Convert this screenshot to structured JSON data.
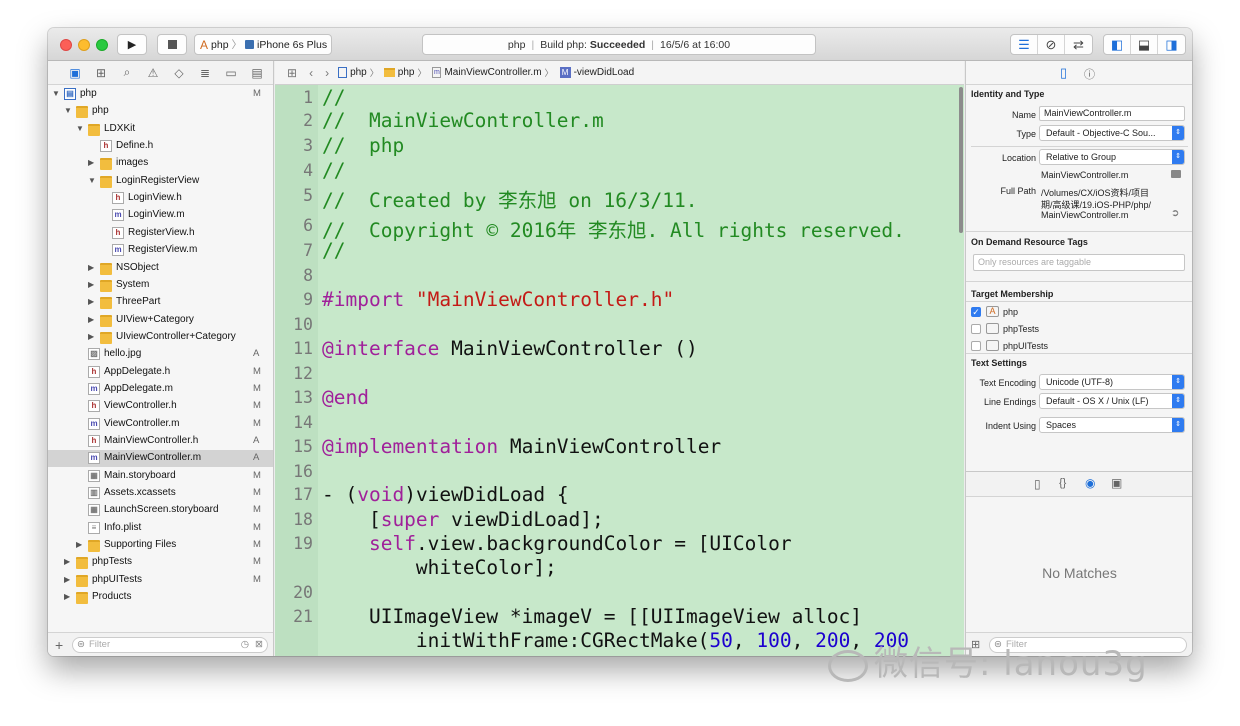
{
  "toolbar": {
    "scheme": "php",
    "device": "iPhone 6s Plus",
    "activity": {
      "project": "php",
      "status_prefix": "Build php: ",
      "status": "Succeeded",
      "timestamp": "16/5/6 at 16:00"
    }
  },
  "navigator": {
    "items": [
      {
        "label": "php",
        "type": "proj",
        "indent": 0,
        "tri": "open",
        "status": "M"
      },
      {
        "label": "php",
        "type": "folder",
        "indent": 1,
        "tri": "open",
        "status": ""
      },
      {
        "label": "LDXKit",
        "type": "folder",
        "indent": 2,
        "tri": "open",
        "status": ""
      },
      {
        "label": "Define.h",
        "type": "h",
        "indent": 3,
        "tri": "",
        "status": ""
      },
      {
        "label": "images",
        "type": "folder",
        "indent": 3,
        "tri": "closed",
        "status": ""
      },
      {
        "label": "LoginRegisterView",
        "type": "folder",
        "indent": 3,
        "tri": "open",
        "status": ""
      },
      {
        "label": "LoginView.h",
        "type": "h",
        "indent": 4,
        "tri": "",
        "status": ""
      },
      {
        "label": "LoginView.m",
        "type": "m",
        "indent": 4,
        "tri": "",
        "status": ""
      },
      {
        "label": "RegisterView.h",
        "type": "h",
        "indent": 4,
        "tri": "",
        "status": ""
      },
      {
        "label": "RegisterView.m",
        "type": "m",
        "indent": 4,
        "tri": "",
        "status": ""
      },
      {
        "label": "NSObject",
        "type": "folder",
        "indent": 3,
        "tri": "closed",
        "status": ""
      },
      {
        "label": "System",
        "type": "folder",
        "indent": 3,
        "tri": "closed",
        "status": ""
      },
      {
        "label": "ThreePart",
        "type": "folder",
        "indent": 3,
        "tri": "closed",
        "status": ""
      },
      {
        "label": "UIView+Category",
        "type": "folder",
        "indent": 3,
        "tri": "closed",
        "status": ""
      },
      {
        "label": "UIviewController+Category",
        "type": "folder",
        "indent": 3,
        "tri": "closed",
        "status": ""
      },
      {
        "label": "hello.jpg",
        "type": "img",
        "indent": 2,
        "tri": "",
        "status": "A"
      },
      {
        "label": "AppDelegate.h",
        "type": "h",
        "indent": 2,
        "tri": "",
        "status": "M"
      },
      {
        "label": "AppDelegate.m",
        "type": "m",
        "indent": 2,
        "tri": "",
        "status": "M"
      },
      {
        "label": "ViewController.h",
        "type": "h",
        "indent": 2,
        "tri": "",
        "status": "M"
      },
      {
        "label": "ViewController.m",
        "type": "m",
        "indent": 2,
        "tri": "",
        "status": "M"
      },
      {
        "label": "MainViewController.h",
        "type": "h",
        "indent": 2,
        "tri": "",
        "status": "A"
      },
      {
        "label": "MainViewController.m",
        "type": "m",
        "indent": 2,
        "tri": "",
        "status": "A",
        "selected": true
      },
      {
        "label": "Main.storyboard",
        "type": "sb",
        "indent": 2,
        "tri": "",
        "status": "M"
      },
      {
        "label": "Assets.xcassets",
        "type": "asset",
        "indent": 2,
        "tri": "",
        "status": "M"
      },
      {
        "label": "LaunchScreen.storyboard",
        "type": "sb",
        "indent": 2,
        "tri": "",
        "status": "M"
      },
      {
        "label": "Info.plist",
        "type": "plist",
        "indent": 2,
        "tri": "",
        "status": "M"
      },
      {
        "label": "Supporting Files",
        "type": "folder",
        "indent": 2,
        "tri": "closed",
        "status": "M"
      },
      {
        "label": "phpTests",
        "type": "folder",
        "indent": 1,
        "tri": "closed",
        "status": "M"
      },
      {
        "label": "phpUITests",
        "type": "folder",
        "indent": 1,
        "tri": "closed",
        "status": "M"
      },
      {
        "label": "Products",
        "type": "folder",
        "indent": 1,
        "tri": "closed",
        "status": ""
      }
    ],
    "filter_placeholder": "Filter"
  },
  "jumpbar": {
    "crumbs": [
      "php",
      "php",
      "MainViewController.m",
      "-viewDidLoad"
    ]
  },
  "editor": {
    "lines": [
      {
        "n": "1",
        "segs": [
          [
            "cm",
            "//"
          ]
        ]
      },
      {
        "n": "2",
        "segs": [
          [
            "cm",
            "//  MainViewController.m"
          ]
        ]
      },
      {
        "n": "3",
        "segs": [
          [
            "cm",
            "//  php"
          ]
        ]
      },
      {
        "n": "4",
        "segs": [
          [
            "cm",
            "//"
          ]
        ]
      },
      {
        "n": "5",
        "segs": [
          [
            "cm",
            "//  Created by 李东旭 on 16/3/11."
          ]
        ]
      },
      {
        "n": "6",
        "segs": [
          [
            "cm",
            "//  Copyright © 2016年 李东旭. All rights reserved."
          ]
        ]
      },
      {
        "n": "7",
        "segs": [
          [
            "cm",
            "//"
          ]
        ]
      },
      {
        "n": "8",
        "segs": []
      },
      {
        "n": "9",
        "segs": [
          [
            "kw",
            "#import "
          ],
          [
            "str",
            "\"MainViewController.h\""
          ]
        ]
      },
      {
        "n": "10",
        "segs": []
      },
      {
        "n": "11",
        "segs": [
          [
            "kw",
            "@interface"
          ],
          [
            "",
            " MainViewController ()"
          ]
        ]
      },
      {
        "n": "12",
        "segs": []
      },
      {
        "n": "13",
        "segs": [
          [
            "kw",
            "@end"
          ]
        ]
      },
      {
        "n": "14",
        "segs": []
      },
      {
        "n": "15",
        "segs": [
          [
            "kw",
            "@implementation"
          ],
          [
            "",
            " MainViewController"
          ]
        ]
      },
      {
        "n": "16",
        "segs": []
      },
      {
        "n": "17",
        "segs": [
          [
            "",
            "- ("
          ],
          [
            "kw",
            "void"
          ],
          [
            "",
            ")viewDidLoad {"
          ]
        ]
      },
      {
        "n": "18",
        "segs": [
          [
            "",
            "    ["
          ],
          [
            "kw",
            "super"
          ],
          [
            "",
            " viewDidLoad];"
          ]
        ]
      },
      {
        "n": "19",
        "segs": [
          [
            "",
            "    "
          ],
          [
            "kw",
            "self"
          ],
          [
            "",
            ".view.backgroundColor = [UIColor"
          ]
        ]
      },
      {
        "n": "",
        "segs": [
          [
            "",
            "        whiteColor];"
          ]
        ]
      },
      {
        "n": "20",
        "segs": []
      },
      {
        "n": "21",
        "segs": [
          [
            "",
            "    UIImageView *imageV = [[UIImageView alloc]"
          ]
        ]
      },
      {
        "n": "",
        "segs": [
          [
            "",
            "        initWithFrame:CGRectMake("
          ],
          [
            "num",
            "50"
          ],
          [
            "",
            ", "
          ],
          [
            "num",
            "100"
          ],
          [
            "",
            ", "
          ],
          [
            "num",
            "200"
          ],
          [
            "",
            ", "
          ],
          [
            "num",
            "200"
          ]
        ]
      }
    ]
  },
  "inspector": {
    "identity_title": "Identity and Type",
    "name_label": "Name",
    "name_value": "MainViewController.m",
    "type_label": "Type",
    "type_value": "Default - Objective-C Sou...",
    "location_label": "Location",
    "location_value": "Relative to Group",
    "location_file": "MainViewController.m",
    "fullpath_label": "Full Path",
    "fullpath_lines": [
      "/Volumes/CX/iOS资料/项目",
      "期/高级课/19.iOS-PHP/php/",
      "MainViewController.m"
    ],
    "odr_title": "On Demand Resource Tags",
    "odr_placeholder": "Only resources are taggable",
    "target_title": "Target Membership",
    "targets": [
      {
        "name": "php",
        "checked": true
      },
      {
        "name": "phpTests",
        "checked": false
      },
      {
        "name": "phpUITests",
        "checked": false
      }
    ],
    "text_title": "Text Settings",
    "encoding_label": "Text Encoding",
    "encoding_value": "Unicode (UTF-8)",
    "endings_label": "Line Endings",
    "endings_value": "Default - OS X / Unix (LF)",
    "indent_label": "Indent Using",
    "indent_value": "Spaces",
    "no_matches": "No Matches",
    "filter_placeholder": "Filter"
  },
  "watermark": "微信号: lanou3g",
  "colors": {
    "editor_bg": "#c7e8ca",
    "comment": "#228a22",
    "keyword": "#a0209a",
    "string": "#c41a16",
    "number": "#1c00cf",
    "accent": "#2f7bf0"
  }
}
